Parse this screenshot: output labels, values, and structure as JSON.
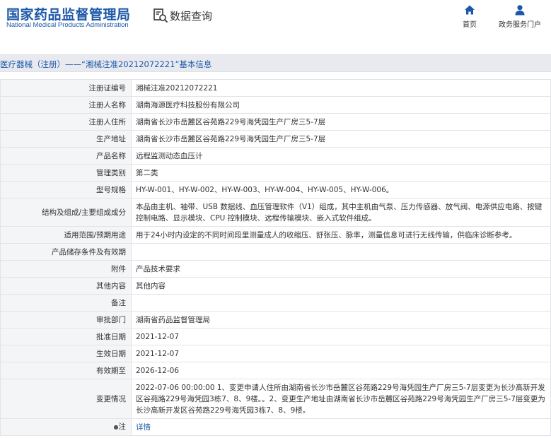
{
  "header": {
    "logo_cn": "国家药品监督管理局",
    "logo_en": "National Medical Products Administration",
    "query_label": "数据查询",
    "nav_home": "首页",
    "nav_gov": "政务服务门户"
  },
  "title": "医疗器械（注册）——“湘械注准20212072221”基本信息",
  "rows": [
    {
      "label": "注册证编号",
      "value": "湘械注准20212072221"
    },
    {
      "label": "注册人名称",
      "value": "湖南海源医疗科技股份有限公司"
    },
    {
      "label": "注册人住所",
      "value": "湖南省长沙市岳麓区谷苑路229号海凭园生产厂房三5-7层"
    },
    {
      "label": "生产地址",
      "value": "湖南省长沙市岳麓区谷苑路229号海凭园生产厂房三5-7层"
    },
    {
      "label": "产品名称",
      "value": "远程监测动态血压计"
    },
    {
      "label": "管理类别",
      "value": "第二类"
    },
    {
      "label": "型号规格",
      "value": "HY-W-001、HY-W-002、HY-W-003、HY-W-004、HY-W-005、HY-W-006。"
    },
    {
      "label": "结构及组成/主要组成成分",
      "value": "本品由主机、袖带、USB 数据线、血压管理软件（V1）组成，其中主机由气泵、压力传感器、放气阀、电源供应电路、按键控制电路、显示模块、CPU 控制模块、远程传输模块、嵌入式软件组成。"
    },
    {
      "label": "适用范围/预期用途",
      "value": "用于24小时内设定的不同时间段里测量成人的收缩压、舒张压、脉率，测量信息可进行无线传输，供临床诊断参考。"
    },
    {
      "label": "产品储存条件及有效期",
      "value": ""
    },
    {
      "label": "附件",
      "value": "产品技术要求"
    },
    {
      "label": "其他内容",
      "value": "其他内容"
    },
    {
      "label": "备注",
      "value": ""
    },
    {
      "label": "审批部门",
      "value": "湖南省药品监督管理局"
    },
    {
      "label": "批准日期",
      "value": "2021-12-07"
    },
    {
      "label": "生效日期",
      "value": "2021-12-07"
    },
    {
      "label": "有效期至",
      "value": "2026-12-06"
    },
    {
      "label": "变更情况",
      "value": "2022-07-06 00:00:00 1、变更申请人住所由湖南省长沙市岳麓区谷苑路229号海凭园生产厂房三5-7层变更为长沙高新开发区谷苑路229号海凭园3栋7、8、9楼。。2、变更生产地址由湖南省长沙市岳麓区谷苑路229号海凭园生产厂房三5-7层变更为长沙高新开发区谷苑路229号海凭园3栋7、8、9楼。"
    }
  ],
  "note": {
    "label": "注",
    "link": "详情"
  },
  "colors": {
    "brand": "#1d58a8",
    "label_bg": "#f4f5f7",
    "title_bg": "#e8eaef"
  }
}
